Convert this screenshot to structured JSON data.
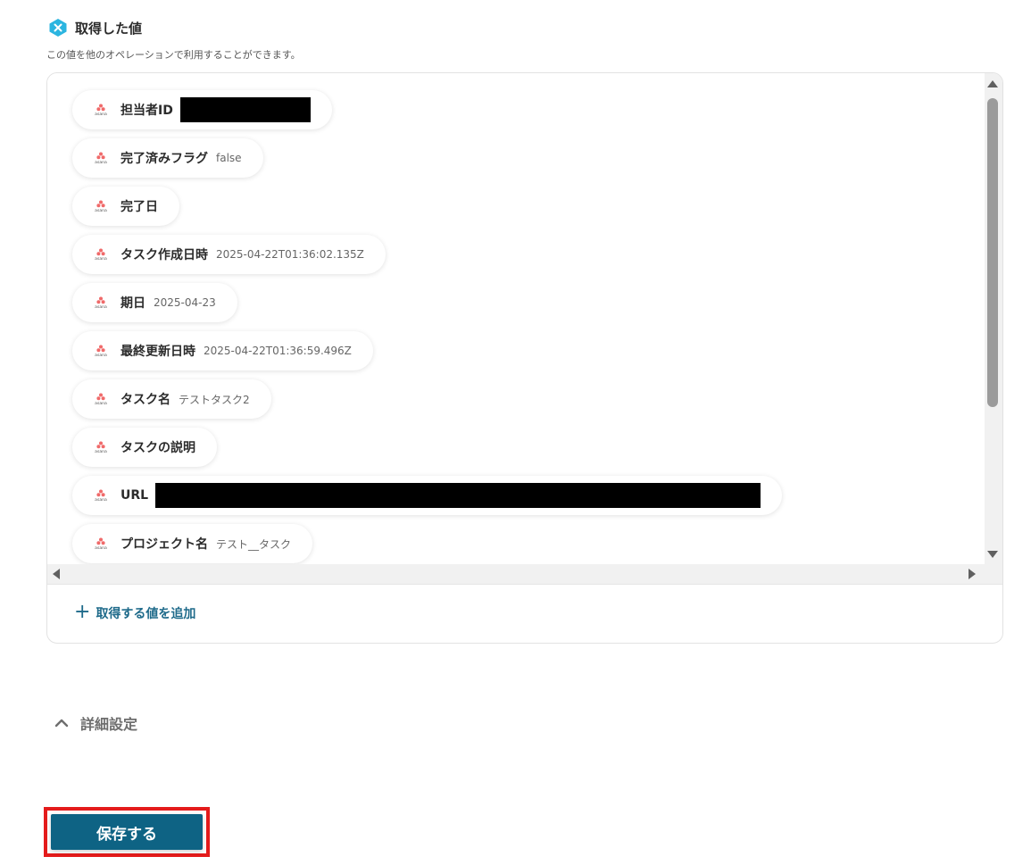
{
  "header": {
    "title": "取得した値",
    "icon": "x-badge-icon",
    "description": "この値を他のオペレーションで利用することができます。"
  },
  "values_panel": {
    "items": [
      {
        "label": "担当者ID",
        "value": "",
        "redacted": true
      },
      {
        "label": "完了済みフラグ",
        "value": "false",
        "redacted": false
      },
      {
        "label": "完了日",
        "value": "",
        "redacted": false
      },
      {
        "label": "タスク作成日時",
        "value": "2025-04-22T01:36:02.135Z",
        "redacted": false
      },
      {
        "label": "期日",
        "value": "2025-04-23",
        "redacted": false
      },
      {
        "label": "最終更新日時",
        "value": "2025-04-22T01:36:59.496Z",
        "redacted": false
      },
      {
        "label": "タスク名",
        "value": "テストタスク2",
        "redacted": false
      },
      {
        "label": "タスクの説明",
        "value": "",
        "redacted": false
      },
      {
        "label": "URL",
        "value": "",
        "redacted": true
      },
      {
        "label": "プロジェクト名",
        "value": "テスト__タスク",
        "redacted": false
      }
    ],
    "item_icon": "asana-logo-icon",
    "add_label": "取得する値を追加"
  },
  "details": {
    "label": "詳細設定",
    "icon": "chevron-up-icon"
  },
  "actions": {
    "save_label": "保存する"
  },
  "colors": {
    "accent": "#0e6384",
    "link": "#1e6a8a",
    "highlight": "#e41b1b",
    "asana_red": "#f06a6a",
    "badge": "#2bb5e0"
  }
}
